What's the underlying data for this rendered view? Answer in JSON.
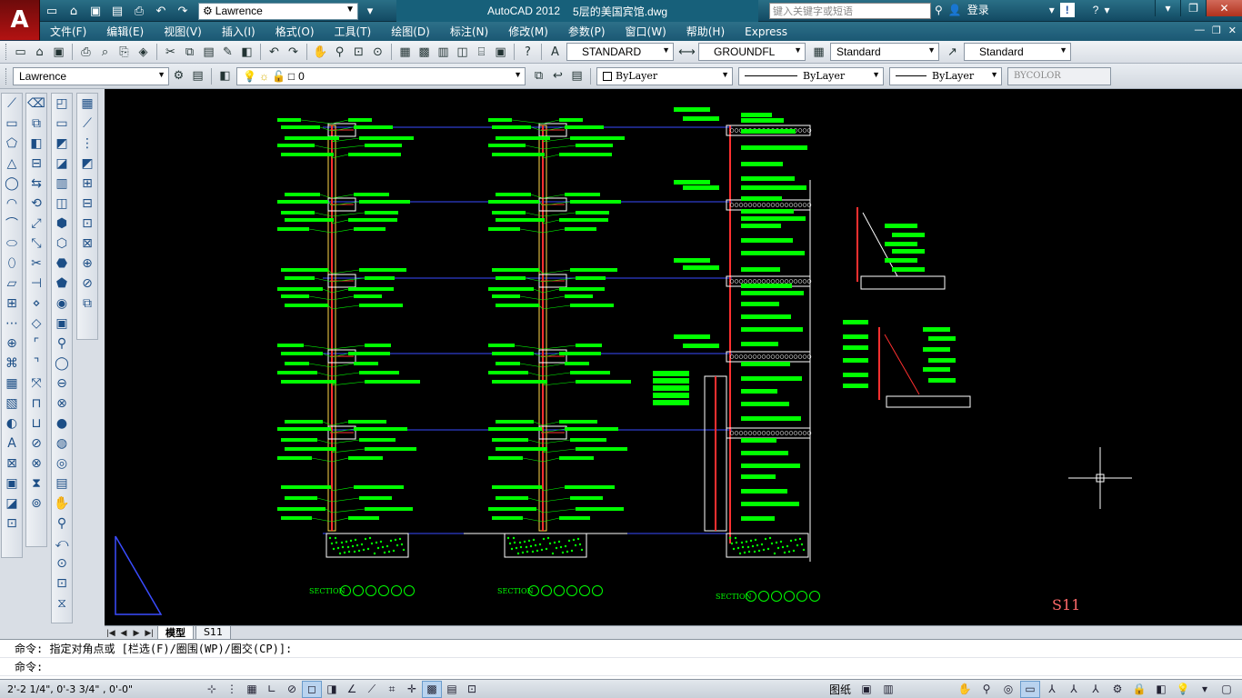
{
  "app": {
    "logo_letter": "A",
    "title": "AutoCAD 2012",
    "document": "5层的美国宾馆.dwg",
    "workspace": "Lawrence",
    "search_placeholder": "键入关键字或短语",
    "login": "登录"
  },
  "menu": [
    "文件(F)",
    "编辑(E)",
    "视图(V)",
    "插入(I)",
    "格式(O)",
    "工具(T)",
    "绘图(D)",
    "标注(N)",
    "修改(M)",
    "参数(P)",
    "窗口(W)",
    "帮助(H)",
    "Express"
  ],
  "styles": {
    "text_style": "STANDARD",
    "dim_style": "GROUNDFL",
    "table_style": "Standard",
    "mleader_style": "Standard"
  },
  "layers": {
    "workspace_combo": "Lawrence",
    "current_layer": "0",
    "color": "ByLayer",
    "linetype": "ByLayer",
    "lineweight": "ByLayer",
    "plotstyle": "BYCOLOR"
  },
  "drawing": {
    "section_label": "SECTION",
    "sheet_label": "S11",
    "accent_green": "#00ff00",
    "sheet_label_color": "#ff6a6a"
  },
  "tabs": {
    "model": "模型",
    "layout": "S11"
  },
  "command": {
    "history": "命令: 指定对角点或 [栏选(F)/圈围(WP)/圈交(CP)]:",
    "prompt": "命令:"
  },
  "status": {
    "coordinates": "2'-2 1/4\",  0'-3 3/4\" , 0'-0\"",
    "paper_label": "图纸"
  }
}
